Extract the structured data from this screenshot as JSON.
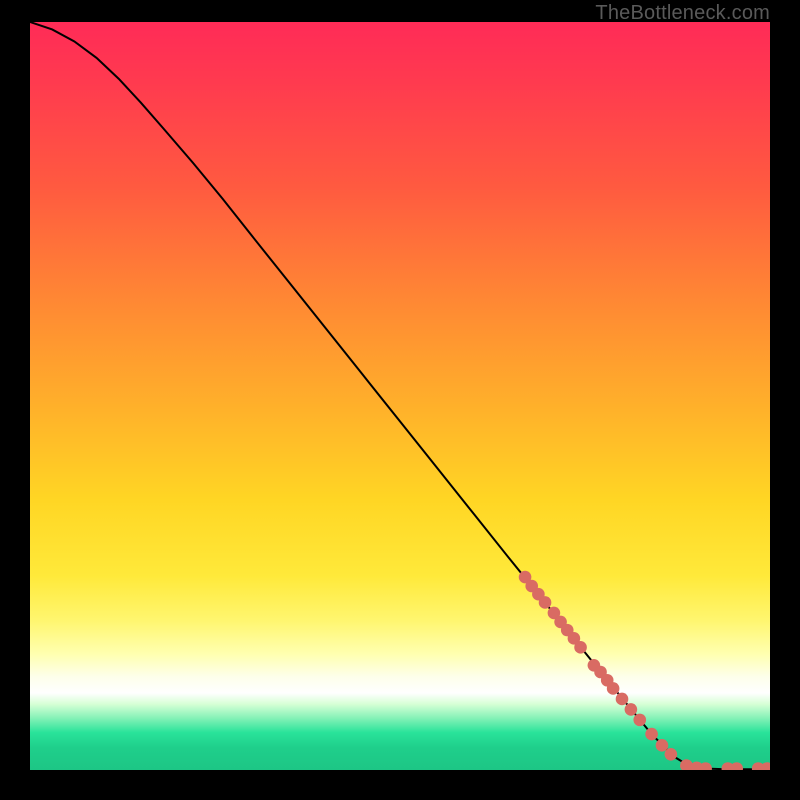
{
  "watermark": "TheBottleneck.com",
  "colors": {
    "curve": "#000000",
    "points": "#d96b63",
    "gradient_top": "#ff2b57",
    "gradient_bottom": "#1dc685"
  },
  "chart_data": {
    "type": "line",
    "title": "",
    "xlabel": "",
    "ylabel": "",
    "xlim": [
      0,
      100
    ],
    "ylim": [
      0,
      100
    ],
    "grid": false,
    "legend": false,
    "curve": [
      {
        "x": 0,
        "y": 100.0
      },
      {
        "x": 3,
        "y": 99.0
      },
      {
        "x": 6,
        "y": 97.4
      },
      {
        "x": 9,
        "y": 95.2
      },
      {
        "x": 12,
        "y": 92.4
      },
      {
        "x": 15,
        "y": 89.2
      },
      {
        "x": 18,
        "y": 85.8
      },
      {
        "x": 22,
        "y": 81.2
      },
      {
        "x": 26,
        "y": 76.4
      },
      {
        "x": 30,
        "y": 71.4
      },
      {
        "x": 35,
        "y": 65.2
      },
      {
        "x": 40,
        "y": 59.0
      },
      {
        "x": 45,
        "y": 52.8
      },
      {
        "x": 50,
        "y": 46.6
      },
      {
        "x": 55,
        "y": 40.4
      },
      {
        "x": 60,
        "y": 34.2
      },
      {
        "x": 65,
        "y": 28.0
      },
      {
        "x": 70,
        "y": 21.9
      },
      {
        "x": 75,
        "y": 15.7
      },
      {
        "x": 80,
        "y": 9.6
      },
      {
        "x": 84,
        "y": 4.8
      },
      {
        "x": 87,
        "y": 1.8
      },
      {
        "x": 89,
        "y": 0.6
      },
      {
        "x": 91,
        "y": 0.2
      },
      {
        "x": 94,
        "y": 0.1
      },
      {
        "x": 97,
        "y": 0.1
      },
      {
        "x": 100,
        "y": 0.1
      }
    ],
    "points": [
      {
        "x": 66.9,
        "y": 25.8
      },
      {
        "x": 67.8,
        "y": 24.6
      },
      {
        "x": 68.7,
        "y": 23.5
      },
      {
        "x": 69.6,
        "y": 22.4
      },
      {
        "x": 70.8,
        "y": 21.0
      },
      {
        "x": 71.7,
        "y": 19.8
      },
      {
        "x": 72.6,
        "y": 18.7
      },
      {
        "x": 73.5,
        "y": 17.6
      },
      {
        "x": 74.4,
        "y": 16.4
      },
      {
        "x": 76.2,
        "y": 14.0
      },
      {
        "x": 77.1,
        "y": 13.1
      },
      {
        "x": 78.0,
        "y": 12.0
      },
      {
        "x": 78.8,
        "y": 10.9
      },
      {
        "x": 80.0,
        "y": 9.5
      },
      {
        "x": 81.2,
        "y": 8.1
      },
      {
        "x": 82.4,
        "y": 6.7
      },
      {
        "x": 84.0,
        "y": 4.8
      },
      {
        "x": 85.4,
        "y": 3.3
      },
      {
        "x": 86.6,
        "y": 2.1
      },
      {
        "x": 88.7,
        "y": 0.6
      },
      {
        "x": 90.1,
        "y": 0.3
      },
      {
        "x": 91.3,
        "y": 0.2
      },
      {
        "x": 94.3,
        "y": 0.2
      },
      {
        "x": 95.5,
        "y": 0.2
      },
      {
        "x": 98.4,
        "y": 0.2
      },
      {
        "x": 99.6,
        "y": 0.2
      }
    ],
    "point_radius": 6.3
  }
}
